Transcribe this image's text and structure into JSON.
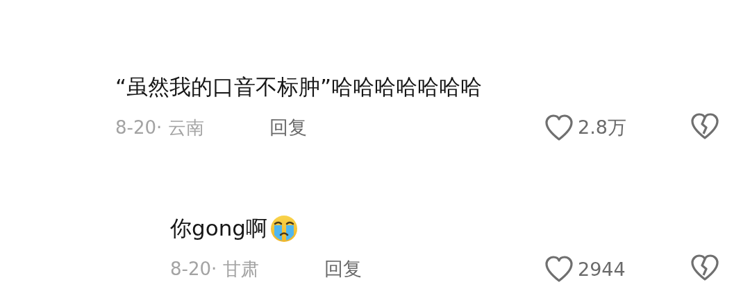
{
  "comments": [
    {
      "text": "“虽然我的口音不标肿”哈哈哈哈哈哈哈",
      "has_emoji": false,
      "date_location": "8-20· 云南",
      "reply_label": "回复",
      "likes": "2.8万",
      "liked": false,
      "children": [
        {
          "text": "你gong啊",
          "has_emoji": true,
          "date_location": "8-20· 甘肃",
          "reply_label": "回复",
          "likes": "2944",
          "liked": false
        }
      ]
    }
  ]
}
